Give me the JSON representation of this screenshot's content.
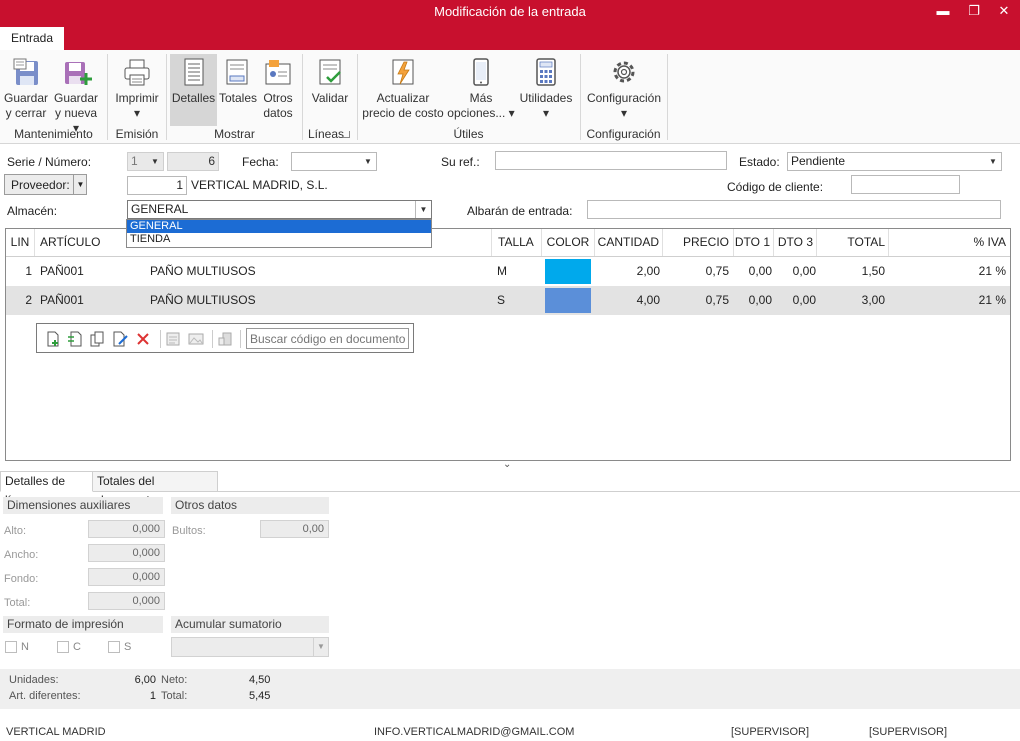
{
  "window": {
    "title": "Modificación de la entrada",
    "minimize": "▬",
    "maximize": "❐",
    "close": "✕"
  },
  "ribbon": {
    "tab": "Entrada",
    "buttons": {
      "guardar_cerrar": [
        "Guardar",
        "y cerrar"
      ],
      "guardar_nueva": [
        "Guardar",
        "y nueva ▾"
      ],
      "imprimir": [
        "Imprimir",
        "▾"
      ],
      "detalles": "Detalles",
      "totales": "Totales",
      "otros_datos": [
        "Otros",
        "datos"
      ],
      "validar": "Validar",
      "actualizar": [
        "Actualizar",
        "precio de costo"
      ],
      "mas_opciones": [
        "Más",
        "opciones... ▾"
      ],
      "utilidades": [
        "Utilidades",
        "▾"
      ],
      "configuracion": [
        "Configuración",
        "▾"
      ]
    },
    "groups": {
      "mantenimiento": "Mantenimiento",
      "emision": "Emisión",
      "mostrar": "Mostrar",
      "lineas": "Líneas",
      "utiles": "Útiles",
      "configuracion": "Configuración"
    }
  },
  "header": {
    "serie_label": "Serie / Número:",
    "serie_value": "1",
    "numero_value": "6",
    "fecha_label": "Fecha:",
    "fecha_value": "",
    "suref_label": "Su ref.:",
    "suref_value": "",
    "estado_label": "Estado:",
    "estado_value": "Pendiente",
    "proveedor_button": "Proveedor:",
    "proveedor_code": "1",
    "proveedor_name": "VERTICAL MADRID, S.L.",
    "codigo_cliente_label": "Código de cliente:",
    "codigo_cliente_value": "",
    "almacen_label": "Almacén:",
    "almacen_value": "GENERAL",
    "almacen_options": [
      "GENERAL",
      "TIENDA"
    ],
    "albaran_label": "Albarán de entrada:",
    "albaran_value": ""
  },
  "grid": {
    "columns": {
      "lin": "LIN",
      "articulo": "ARTÍCULO",
      "talla": "TALLA",
      "color": "COLOR",
      "cantidad": "CANTIDAD",
      "precio": "PRECIO",
      "dto1": "DTO 1",
      "dto3": "DTO 3",
      "total": "TOTAL",
      "iva": "% IVA"
    },
    "rows": [
      {
        "lin": "1",
        "articulo": "PAÑ001",
        "descripcion": "PAÑO MULTIUSOS",
        "talla": "M",
        "color": "#00a9ec",
        "cantidad": "2,00",
        "precio": "0,75",
        "dto1": "0,00",
        "dto3": "0,00",
        "total": "1,50",
        "iva": "21 %"
      },
      {
        "lin": "2",
        "articulo": "PAÑ001",
        "descripcion": "PAÑO MULTIUSOS",
        "talla": "S",
        "color": "#5b8fd9",
        "cantidad": "4,00",
        "precio": "0,75",
        "dto1": "0,00",
        "dto3": "0,00",
        "total": "3,00",
        "iva": "21 %"
      }
    ],
    "search_placeholder": "Buscar código en documento"
  },
  "details": {
    "tab_linea": "Detalles de línea",
    "tab_totales": "Totales del documento",
    "dimensiones_header": "Dimensiones auxiliares",
    "alto_label": "Alto:",
    "alto_value": "0,000",
    "ancho_label": "Ancho:",
    "ancho_value": "0,000",
    "fondo_label": "Fondo:",
    "fondo_value": "0,000",
    "total_label": "Total:",
    "total_value": "0,000",
    "otros_header": "Otros datos",
    "bultos_label": "Bultos:",
    "bultos_value": "0,00",
    "formato_header": "Formato de impresión",
    "chk_n": "N",
    "chk_c": "C",
    "chk_s": "S",
    "acumular_header": "Acumular sumatorio",
    "acumular_value": ""
  },
  "summary": {
    "unidades_label": "Unidades:",
    "unidades_value": "6,00",
    "art_label": "Art. diferentes:",
    "art_value": "1",
    "neto_label": "Neto:",
    "neto_value": "4,50",
    "total_label": "Total:",
    "total_value": "5,45"
  },
  "statusbar": {
    "company": "VERTICAL MADRID",
    "email": "INFO.VERTICALMADRID@GMAIL.COM",
    "user1": "[SUPERVISOR]",
    "user2": "[SUPERVISOR]"
  },
  "colors": {
    "brand": "#c8102e",
    "selection": "#1c6cd4"
  }
}
